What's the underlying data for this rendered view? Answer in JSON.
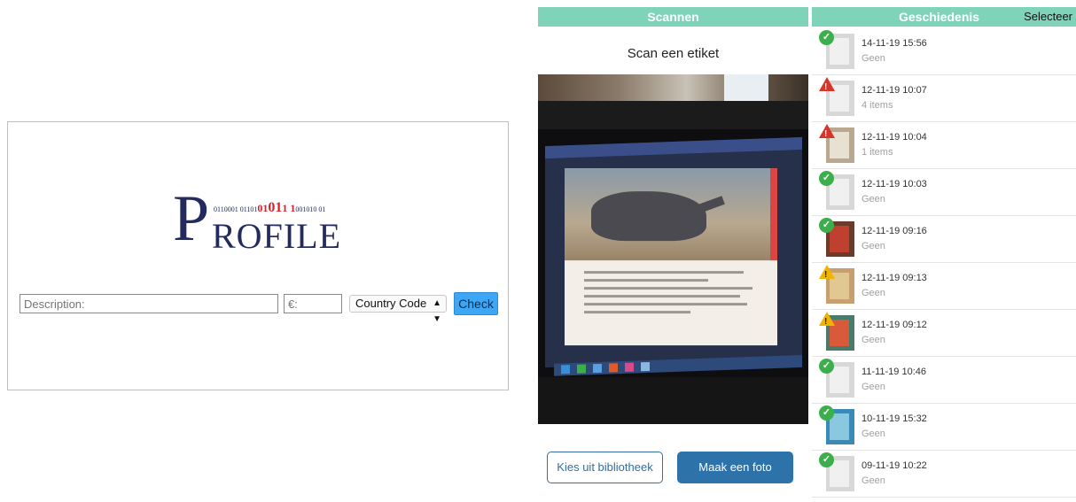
{
  "profile": {
    "logo_letter": "P",
    "logo_binary_a": "0110001 01101",
    "logo_binary_b": "01",
    "logo_binary_c": "01",
    "logo_binary_d": "1 1",
    "logo_binary_e": "001010 01",
    "logo_rest": "ROFILE",
    "description_placeholder": "Description:",
    "euro_placeholder": "€:",
    "country_select": "Country Code",
    "check_label": "Check"
  },
  "scan": {
    "header": "Scannen",
    "title": "Scan een etiket",
    "library_button": "Kies uit bibliotheek",
    "photo_button": "Maak een foto"
  },
  "history": {
    "header": "Geschiedenis",
    "select_label": "Selecteer",
    "rows": [
      {
        "date": "14-11-19 15:56",
        "sub": "Geen",
        "status": "ok"
      },
      {
        "date": "12-11-19 10:07",
        "sub": "4 items",
        "status": "error"
      },
      {
        "date": "12-11-19 10:04",
        "sub": "1 items",
        "status": "error"
      },
      {
        "date": "12-11-19 10:03",
        "sub": "Geen",
        "status": "ok"
      },
      {
        "date": "12-11-19 09:16",
        "sub": "Geen",
        "status": "ok"
      },
      {
        "date": "12-11-19 09:13",
        "sub": "Geen",
        "status": "warning"
      },
      {
        "date": "12-11-19 09:12",
        "sub": "Geen",
        "status": "warning"
      },
      {
        "date": "11-11-19 10:46",
        "sub": "Geen",
        "status": "ok"
      },
      {
        "date": "10-11-19 15:32",
        "sub": "Geen",
        "status": "ok"
      },
      {
        "date": "09-11-19 10:22",
        "sub": "Geen",
        "status": "ok"
      }
    ]
  },
  "colors": {
    "header_green": "#7fd3b8",
    "logo_navy": "#232b5e",
    "logo_red": "#d4202a",
    "button_blue": "#2d72a8",
    "check_blue": "#3da7f5",
    "ok_green": "#3cae4b",
    "error_red": "#d8352a",
    "warning_yellow": "#f0b400"
  }
}
